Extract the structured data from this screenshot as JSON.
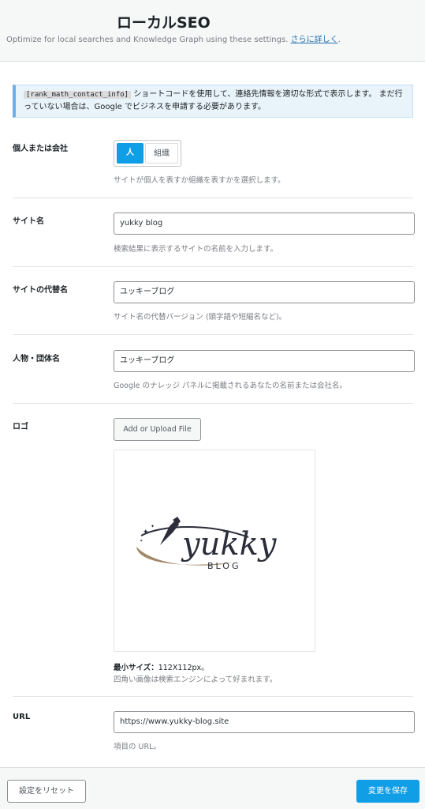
{
  "header": {
    "title": "ローカルSEO",
    "subtitle": "Optimize for local searches and Knowledge Graph using these settings.",
    "learn_more": "さらに詳しく",
    "subtitle_end": "."
  },
  "notice": {
    "code": "[rank_math_contact_info]",
    "text": " ショートコードを使用して、連絡先情報を適切な形式で表示します。 まだ行っていない場合は、Google でビジネスを申請する必要があります。"
  },
  "fields": {
    "entity_type": {
      "label": "個人または会社",
      "options": [
        "人",
        "組織"
      ],
      "selected": "人",
      "description": "サイトが個人を表すか組織を表すかを選択します。"
    },
    "site_name": {
      "label": "サイト名",
      "value": "yukky blog",
      "description": "検索結果に表示するサイトの名前を入力します。"
    },
    "alt_name": {
      "label": "サイトの代替名",
      "value": "ユッキーブログ",
      "description": "サイト名の代替バージョン (頭字語や短縮名など)。"
    },
    "person_name": {
      "label": "人物・団体名",
      "value": "ユッキーブログ",
      "description": "Google のナレッジ パネルに掲載されるあなたの名前または会社名。"
    },
    "logo": {
      "label": "ロゴ",
      "upload_label": "Add or Upload File",
      "logo_text_main": "yukky",
      "logo_text_sub": "BLOG",
      "min_size_label": "最小サイズ：",
      "min_size_value": "112X112px。",
      "hint": "四角い画像は検索エンジンによって好まれます。"
    },
    "url": {
      "label": "URL",
      "value": "https://www.yukky-blog.site",
      "description": "項目の URL。"
    }
  },
  "footer": {
    "reset_label": "設定をリセット",
    "save_label": "変更を保存"
  },
  "colors": {
    "accent": "#109ee6",
    "notice_bg": "#e9f3fa",
    "notice_border": "#72aee6"
  }
}
